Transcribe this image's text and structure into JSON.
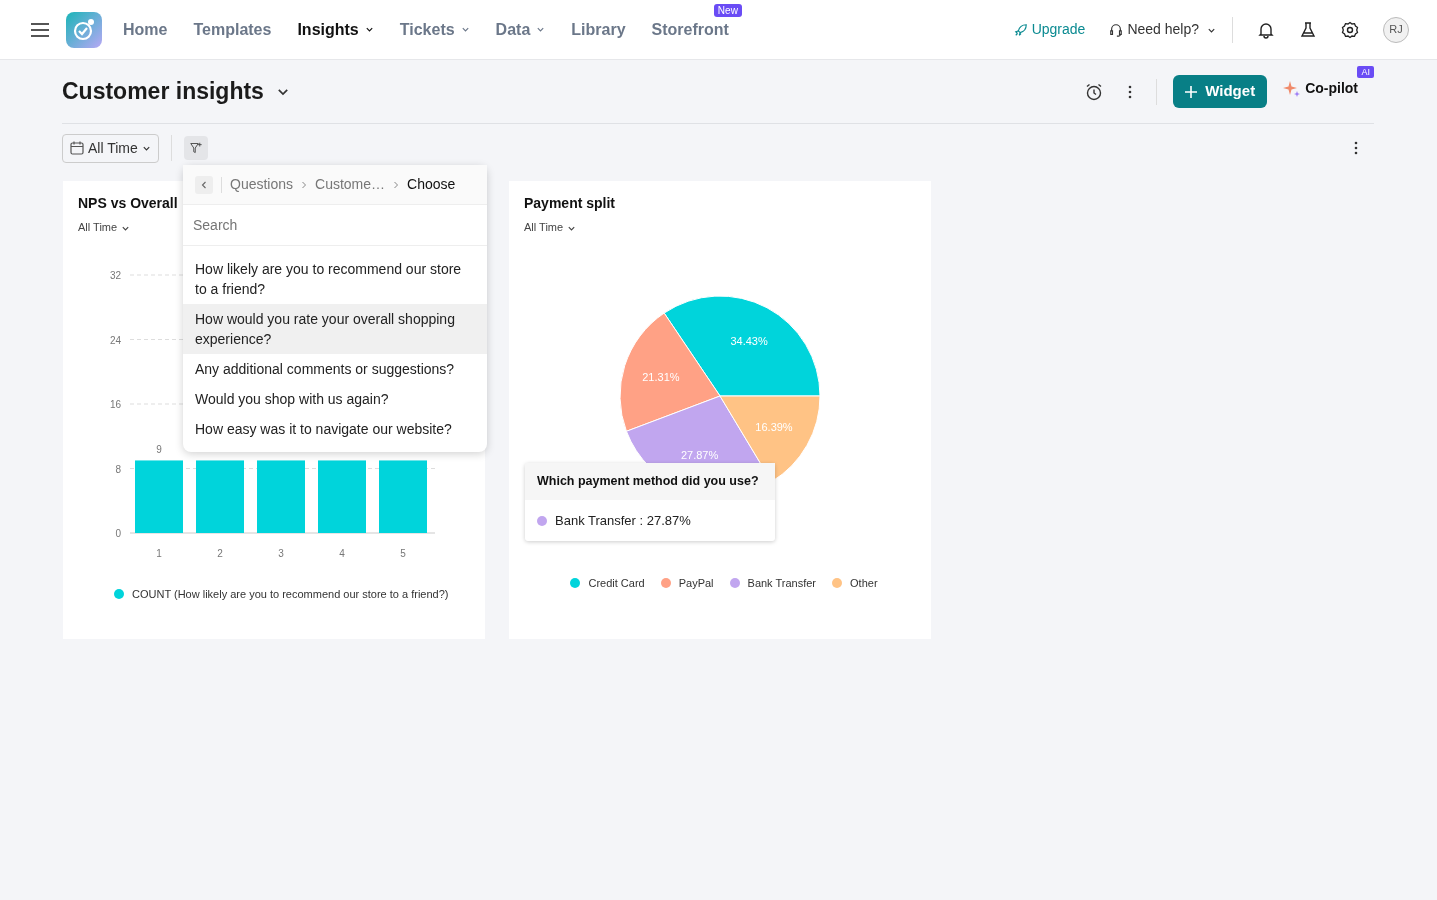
{
  "nav": {
    "items": [
      {
        "label": "Home",
        "selected": false,
        "dropdown": false
      },
      {
        "label": "Templates",
        "selected": false,
        "dropdown": false
      },
      {
        "label": "Insights",
        "selected": true,
        "dropdown": true
      },
      {
        "label": "Tickets",
        "selected": false,
        "dropdown": true
      },
      {
        "label": "Data",
        "selected": false,
        "dropdown": true
      },
      {
        "label": "Library",
        "selected": false,
        "dropdown": false
      },
      {
        "label": "Storefront",
        "selected": false,
        "dropdown": false,
        "badge": "New"
      }
    ],
    "upgrade": "Upgrade",
    "help": "Need help?",
    "avatar": "RJ"
  },
  "header": {
    "title": "Customer insights",
    "widget_button": "Widget",
    "copilot": {
      "label": "Co-pilot",
      "badge": "AI"
    }
  },
  "toolbar": {
    "date_filter": "All Time"
  },
  "popover": {
    "breadcrumbs": [
      "Questions",
      "Custome…",
      "Choose"
    ],
    "search": {
      "placeholder": "Search"
    },
    "options": [
      {
        "label": "How likely are you to recommend our store to a friend?",
        "selected": false
      },
      {
        "label": "How would you rate your overall shopping experience?",
        "selected": true
      },
      {
        "label": "Any additional comments or suggestions?",
        "selected": false
      },
      {
        "label": "Would you shop with us again?",
        "selected": false
      },
      {
        "label": "How easy was it to navigate our website?",
        "selected": false
      }
    ]
  },
  "widgets": [
    {
      "title": "NPS vs Overall",
      "period": "All Time",
      "chart_data": {
        "type": "bar",
        "categories": [
          "1",
          "2",
          "3",
          "4",
          "5"
        ],
        "series": [
          {
            "name": "COUNT (How likely are you to recommend our store to a friend?)",
            "color": "#00d4db",
            "values": [
              9,
              9,
              9,
              9,
              9
            ]
          }
        ],
        "grid": true,
        "legend": "bottom",
        "ylim": [
          0,
          32
        ],
        "yticks": [
          0,
          8,
          16,
          24,
          32
        ],
        "value_labels": [
          "9",
          null,
          null,
          null,
          null
        ]
      }
    },
    {
      "title": "Payment split",
      "period": "All Time",
      "chart_data": {
        "type": "pie",
        "categories": [
          "Credit Card",
          "PayPal",
          "Bank Transfer",
          "Other"
        ],
        "series": [
          {
            "name": "Which payment method did you use?",
            "values": [
              34.43,
              21.31,
              27.87,
              16.39
            ]
          }
        ],
        "colors": [
          "#00d4db",
          "#ffa185",
          "#c1a6ef",
          "#ffc385"
        ],
        "legend": "bottom",
        "value_labels": [
          "34.43%",
          "21.31%",
          "27.87%",
          "16.39%"
        ]
      },
      "tooltip": {
        "text": "Bank Transfer : 27.87%",
        "color": "#c1a6ef"
      }
    }
  ]
}
